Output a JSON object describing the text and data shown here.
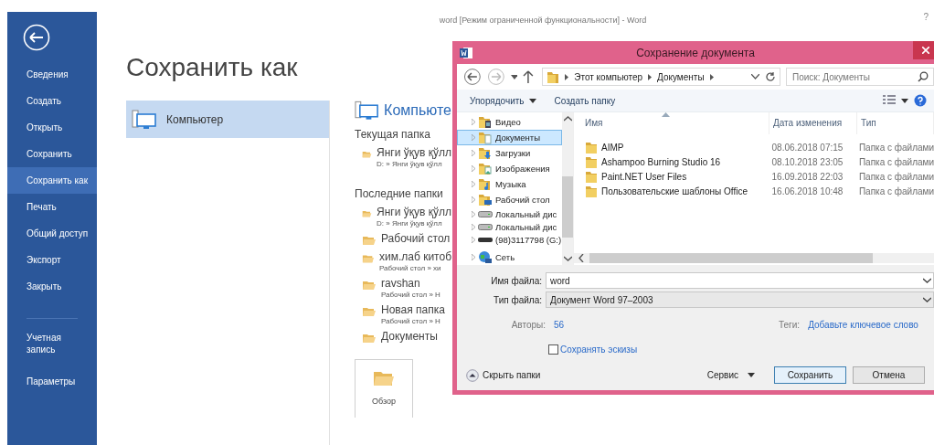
{
  "window": {
    "title": "word [Режим ограниченной функциональности] - Word",
    "help": "?"
  },
  "backstage": {
    "nav": [
      {
        "label": "Сведения",
        "selected": false
      },
      {
        "label": "Создать",
        "selected": false
      },
      {
        "label": "Открыть",
        "selected": false
      },
      {
        "label": "Сохранить",
        "selected": false
      },
      {
        "label": "Сохранить как",
        "selected": true
      },
      {
        "label": "Печать",
        "selected": false
      },
      {
        "label": "Общий доступ",
        "selected": false
      },
      {
        "label": "Экспорт",
        "selected": false
      },
      {
        "label": "Закрыть",
        "selected": false
      }
    ],
    "nav_bottom": [
      {
        "label": "Учетная\nзапись",
        "selected": false
      },
      {
        "label": "Параметры",
        "selected": false
      }
    ],
    "heading": "Сохранить как",
    "places": [
      {
        "label": "Компьютер",
        "selected": true
      }
    ],
    "place_heading": "Компьюте",
    "current_label": "Текущая папка",
    "current": [
      {
        "name": "Янги ўқув қўлл",
        "path": "D: » Янги ўқув қўлл"
      }
    ],
    "recent_label": "Последние папки",
    "recent": [
      {
        "name": "Янги ўқув қўлл",
        "path": "D: » Янги ўқув қўлл"
      },
      {
        "name": "Рабочий стол"
      },
      {
        "name": "хим.лаб китоб",
        "path": "Рабочий стол » хи"
      },
      {
        "name": "ravshan",
        "path": "Рабочий стол » Н"
      },
      {
        "name": "Новая папка",
        "path": "Рабочий стол » Н"
      },
      {
        "name": "Документы"
      }
    ],
    "browse": "Обзор"
  },
  "dialog": {
    "title": "Сохранение документа",
    "address": [
      "Этот компьютер",
      "Документы"
    ],
    "search": {
      "placeholder": "Поиск: Документы"
    },
    "organize": "Упорядочить",
    "new_folder": "Создать папку",
    "tree": [
      {
        "label": "Видео",
        "kind": "video",
        "selected": false
      },
      {
        "label": "Документы",
        "kind": "documents",
        "selected": true
      },
      {
        "label": "Загрузки",
        "kind": "downloads",
        "selected": false
      },
      {
        "label": "Изображения",
        "kind": "pictures",
        "selected": false
      },
      {
        "label": "Музыка",
        "kind": "music",
        "selected": false
      },
      {
        "label": "Рабочий стол",
        "kind": "desktop",
        "selected": false
      },
      {
        "label": "Локальный дис",
        "kind": "disk",
        "selected": false
      },
      {
        "label": "Локальный дис",
        "kind": "disk",
        "selected": false
      },
      {
        "label": "(98)3117798 (G:)",
        "kind": "usb",
        "selected": false
      },
      {
        "label": "Сеть",
        "kind": "network",
        "selected": false
      }
    ],
    "columns": [
      {
        "label": "Имя",
        "sorted": true
      },
      {
        "label": "Дата изменения",
        "sorted": false
      },
      {
        "label": "Тип",
        "sorted": false
      }
    ],
    "files": [
      {
        "name": "AIMP",
        "date": "08.06.2018 07:15",
        "type": "Папка с файлами"
      },
      {
        "name": "Ashampoo Burning Studio 16",
        "date": "08.10.2018 23:05",
        "type": "Папка с файлами"
      },
      {
        "name": "Paint.NET User Files",
        "date": "16.09.2018 22:03",
        "type": "Папка с файлами"
      },
      {
        "name": "Пользовательские шаблоны Office",
        "date": "16.06.2018 10:48",
        "type": "Папка с файлами"
      }
    ],
    "filename": {
      "label": "Имя файла:",
      "value": "word"
    },
    "filetype": {
      "label": "Тип файла:",
      "value": "Документ Word 97–2003"
    },
    "authors": {
      "label": "Авторы:",
      "value": "56"
    },
    "tags": {
      "label": "Теги:",
      "value": "Добавьте ключевое слово"
    },
    "thumbnails": {
      "label": "Сохранять эскизы",
      "checked": false
    },
    "hide_folders": "Скрыть папки",
    "tools": "Сервис",
    "buttons": [
      {
        "label": "Сохранить",
        "default": true
      },
      {
        "label": "Отмена",
        "default": false
      }
    ]
  }
}
